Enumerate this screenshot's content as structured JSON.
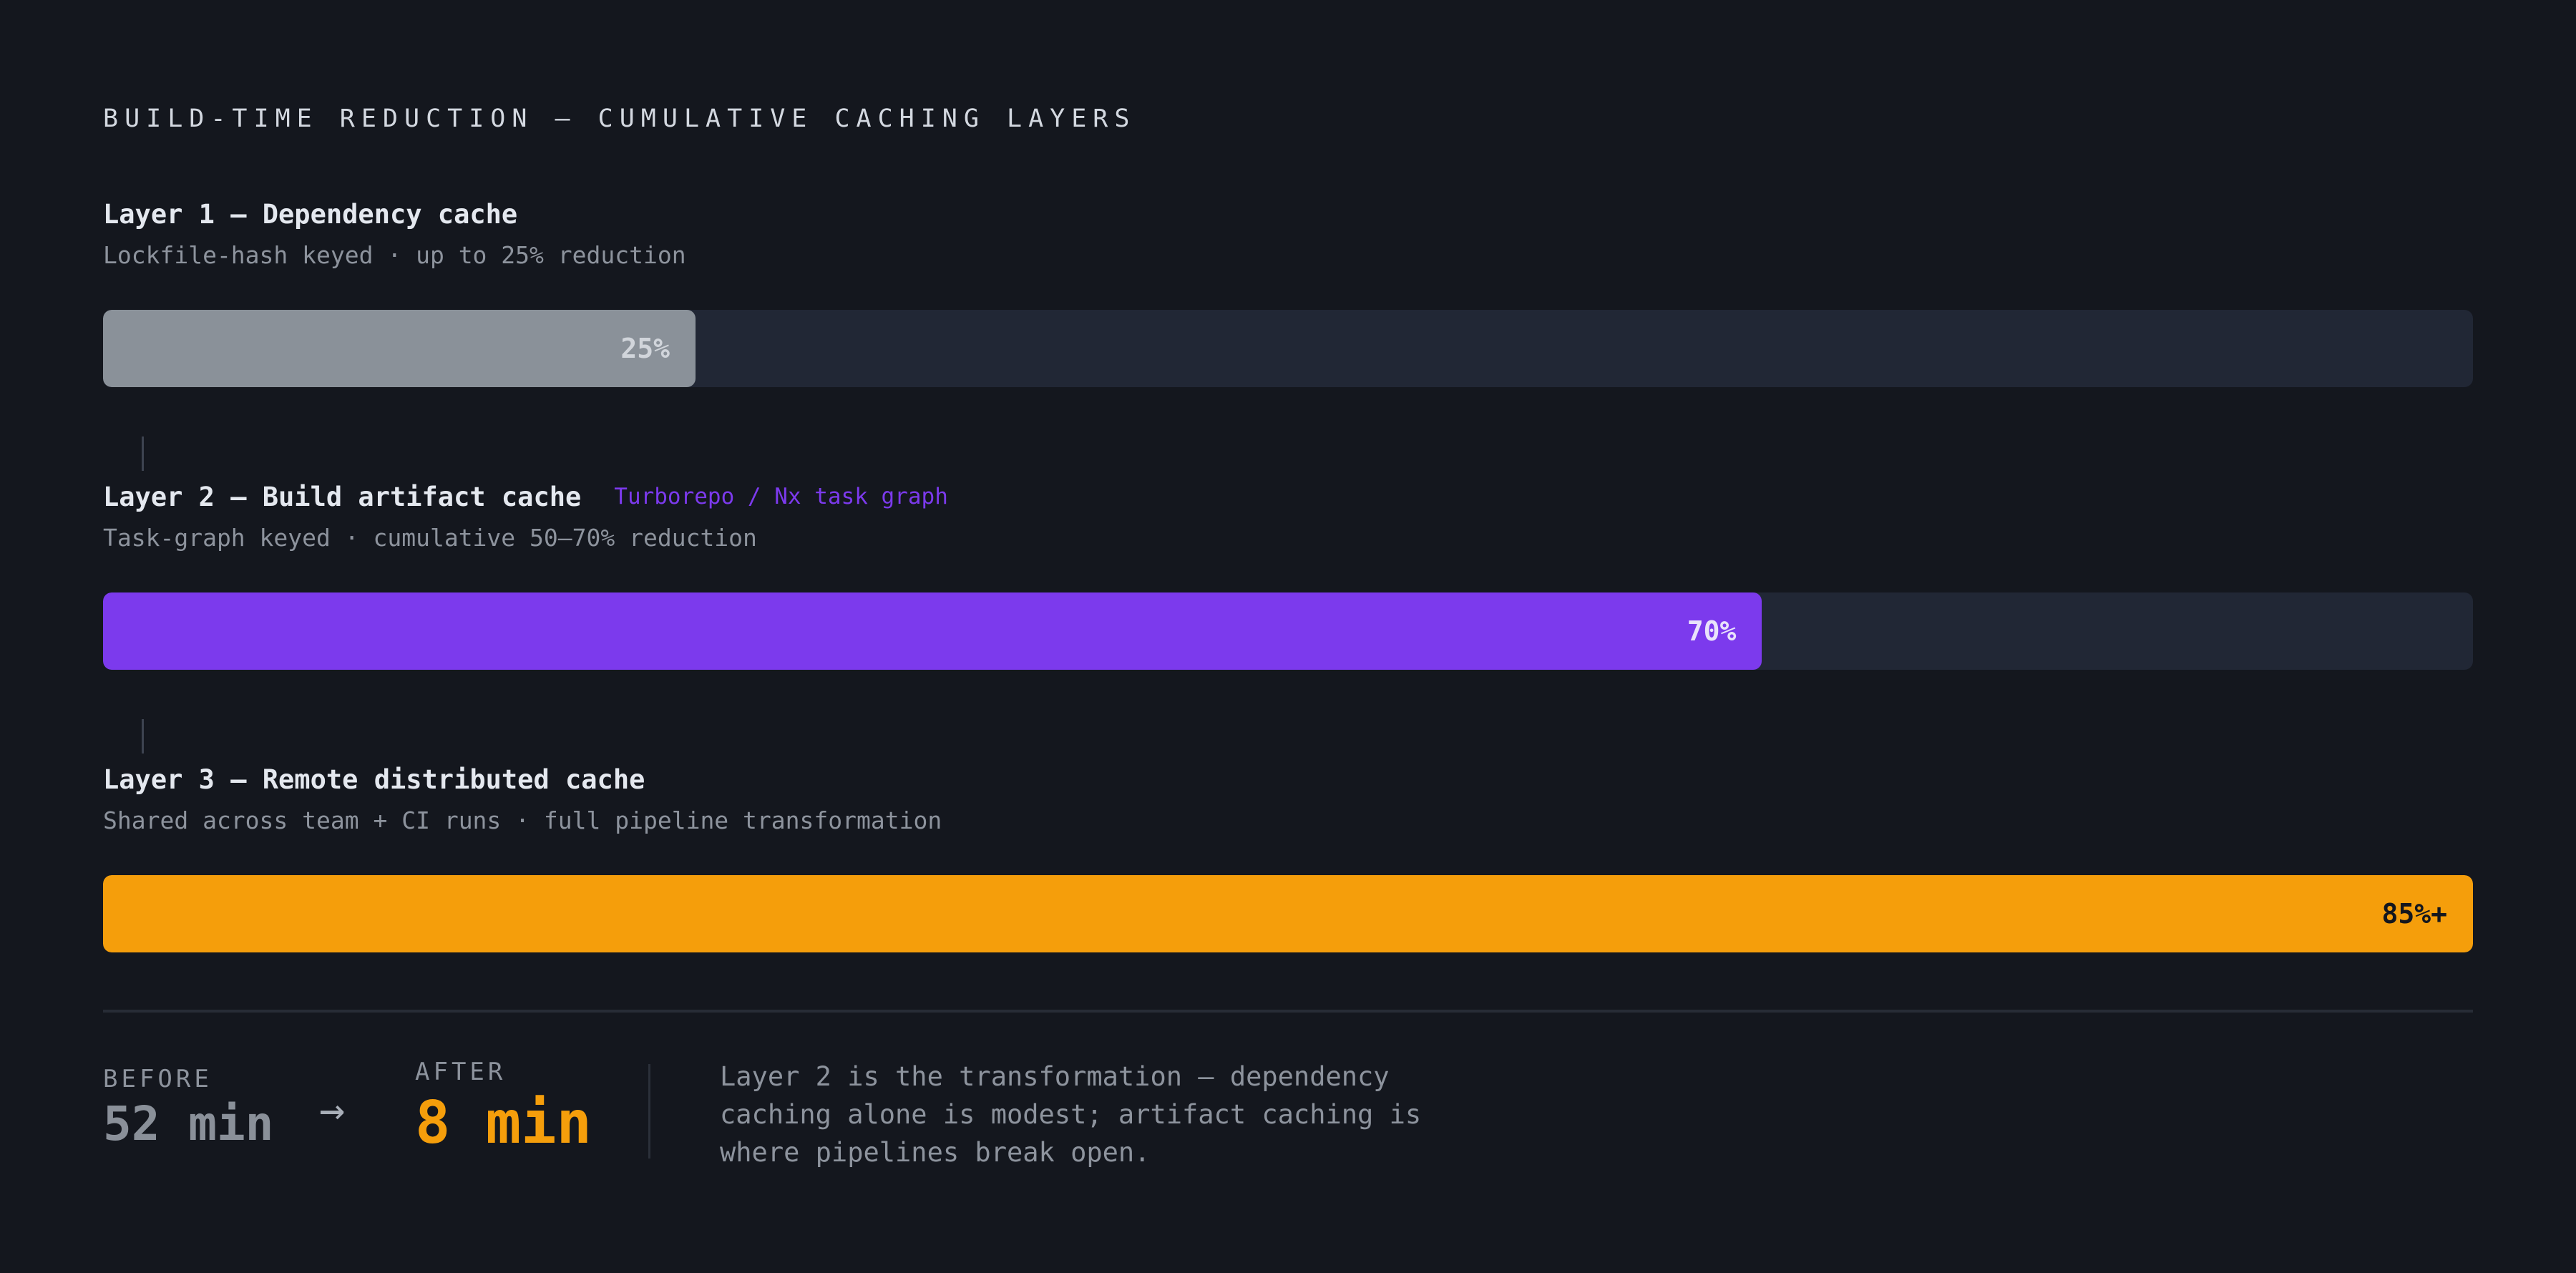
{
  "header": {
    "title": "BUILD-TIME REDUCTION — CUMULATIVE CACHING LAYERS"
  },
  "chart_data": {
    "type": "bar",
    "orientation": "horizontal",
    "title": "BUILD-TIME REDUCTION — CUMULATIVE CACHING LAYERS",
    "xlim": [
      0,
      100
    ],
    "unit": "%",
    "grid": false,
    "layers": [
      {
        "title": "Layer 1 — Dependency cache",
        "subtitle": "Lockfile-hash keyed · up to 25% reduction",
        "tag": "",
        "value": 25,
        "label": "25%",
        "color": "#8a9199",
        "label_color": "#d1d5db"
      },
      {
        "title": "Layer 2 — Build artifact cache",
        "subtitle": "Task-graph keyed · cumulative 50–70% reduction",
        "tag": "Turborepo / Nx task graph",
        "tag_color": "#7c3aed",
        "value": 70,
        "label": "70%",
        "color": "#7c3aed",
        "label_color": "#e9e2fb"
      },
      {
        "title": "Layer 3 — Remote distributed cache",
        "subtitle": "Shared across team + CI runs · full pipeline transformation",
        "tag": "",
        "value": 100,
        "label": "85%+",
        "color": "#f59e0b",
        "label_color": "#14171e"
      }
    ]
  },
  "summary": {
    "before_label": "BEFORE",
    "before_value": "52 min",
    "arrow": "→",
    "after_label": "AFTER",
    "after_value": "8 min",
    "note": "Layer 2 is the transformation — dependency caching alone is modest; artifact caching is where pipelines break open."
  },
  "colors": {
    "background": "#14171e",
    "track": "#212735",
    "accent_purple": "#7c3aed",
    "accent_amber": "#f59e0b"
  }
}
